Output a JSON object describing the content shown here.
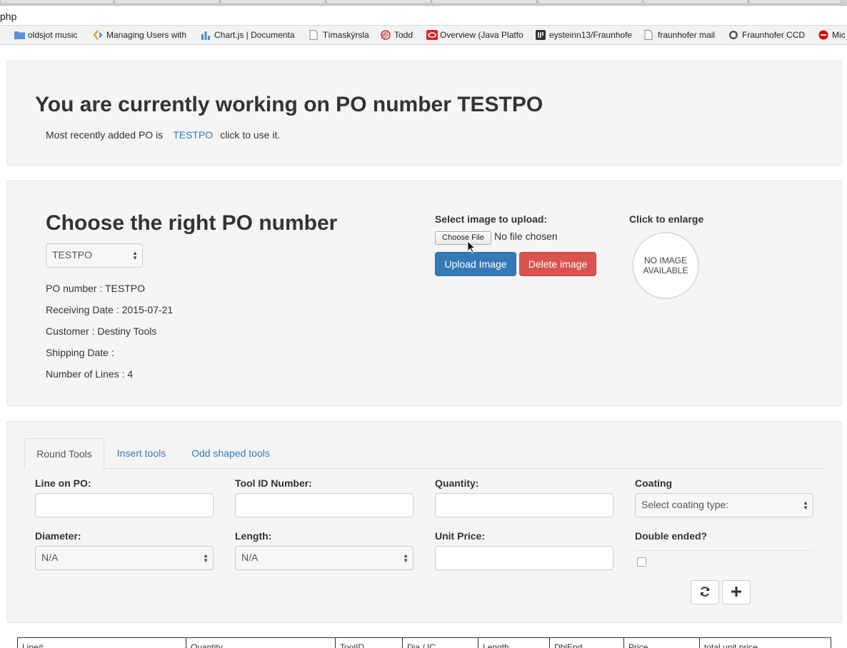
{
  "browser": {
    "url_fragment": "php",
    "bookmarks": [
      {
        "label": "oldsjot music",
        "icon": "folder-icon"
      },
      {
        "label": "Managing Users with",
        "icon": "chevron-logo-icon"
      },
      {
        "label": "Chart.js | Documenta",
        "icon": "bar-chart-icon"
      },
      {
        "label": "Tímaskýrsla",
        "icon": "page-icon"
      },
      {
        "label": "Todd",
        "icon": "striped-circle-icon"
      },
      {
        "label": "Overview (Java Platfo",
        "icon": "oracle-icon"
      },
      {
        "label": "eysteinn13/Fraunhofe",
        "icon": "repo-icon"
      },
      {
        "label": "fraunhofer mail",
        "icon": "page-icon"
      },
      {
        "label": "Fraunhofer CCD",
        "icon": "octocat-icon"
      },
      {
        "label": "Mic",
        "icon": "no-entry-icon"
      }
    ]
  },
  "current": {
    "heading": "You are currently working on PO number TESTPO",
    "recent_prefix": "Most recently added PO is",
    "recent_link": "TESTPO",
    "recent_suffix": "click to use it."
  },
  "choose": {
    "heading": "Choose the right PO number",
    "selected_po": "TESTPO",
    "info": {
      "po_number": "PO number : TESTPO",
      "receiving_date": "Receiving Date : 2015-07-21",
      "customer": "Customer : Destiny Tools",
      "shipping_date": "Shipping Date :",
      "number_of_lines": "Number of Lines : 4"
    },
    "upload_label": "Select image to upload:",
    "choose_file": "Choose File",
    "no_file": "No file chosen",
    "upload_button": "Upload Image",
    "delete_button": "Delete image",
    "enlarge_label": "Click to enlarge",
    "no_image": "NO IMAGE AVAILABLE"
  },
  "tools": {
    "tabs": [
      "Round Tools",
      "Insert tools",
      "Odd shaped tools"
    ],
    "active_tab": "Round Tools",
    "labels": {
      "line": "Line on PO:",
      "tool_id": "Tool ID Number:",
      "quantity": "Quantity:",
      "coating": "Coating",
      "diameter": "Diameter:",
      "length": "Length:",
      "unit_price": "Unit Price:",
      "double_ended": "Double ended?"
    },
    "coating_value": "Select coating type:",
    "diameter_value": "N/A",
    "length_value": "N/A"
  },
  "table": {
    "headers": [
      "Line#",
      "Quantity",
      "ToolID",
      "Dia / IC",
      "Length",
      "DblEnd",
      "Price",
      "total unit price"
    ]
  },
  "colors": {
    "primary": "#337ab7",
    "danger": "#d9534f",
    "well": "#f5f5f5"
  }
}
